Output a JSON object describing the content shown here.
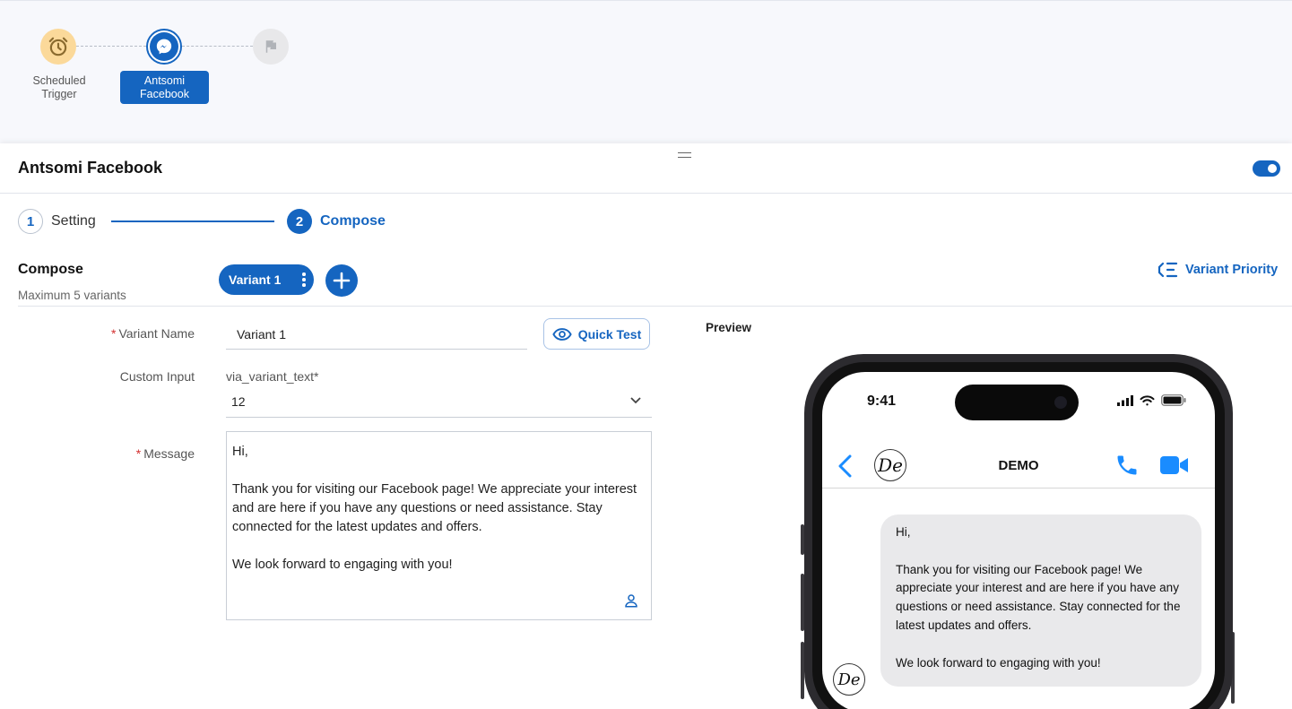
{
  "workflow": {
    "nodes": [
      {
        "label": "Scheduled Trigger",
        "icon": "alarm-clock-icon"
      },
      {
        "label": "Antsomi Facebook",
        "icon": "messenger-icon"
      },
      {
        "label": "",
        "icon": "flag-icon"
      }
    ],
    "colors": {
      "accent": "#1565c0",
      "trigger_bg": "#fbd99a",
      "end_bg": "#e8e8ea"
    }
  },
  "panel": {
    "title": "Antsomi Facebook",
    "enabled": true
  },
  "steps": [
    {
      "number": "1",
      "label": "Setting"
    },
    {
      "number": "2",
      "label": "Compose"
    }
  ],
  "compose": {
    "title": "Compose",
    "subtitle": "Maximum 5 variants",
    "variant_tab": "Variant 1",
    "variant_priority": "Variant Priority"
  },
  "form": {
    "variant_name_label": "Variant Name",
    "variant_name_value": "Variant 1",
    "quick_test": "Quick Test",
    "custom_input_label": "Custom Input",
    "custom_input_key": "via_variant_text*",
    "custom_input_value": "12",
    "message_label": "Message",
    "message_lines": [
      "Hi,",
      "",
      "Thank you for visiting our Facebook page! We appreciate your interest and are here if you have any questions or need assistance. Stay connected for the latest updates and offers.",
      "",
      "We look forward to engaging with you!"
    ]
  },
  "preview": {
    "label": "Preview",
    "time": "9:41",
    "contact_name": "DEMO",
    "avatar_text": "De",
    "bubble_lines": [
      "Hi,",
      "",
      "Thank you for visiting our Facebook page! We appreciate your interest and are here if you have any questions or need assistance. Stay connected for the latest updates and offers.",
      "",
      "We look forward to engaging with you!"
    ]
  }
}
